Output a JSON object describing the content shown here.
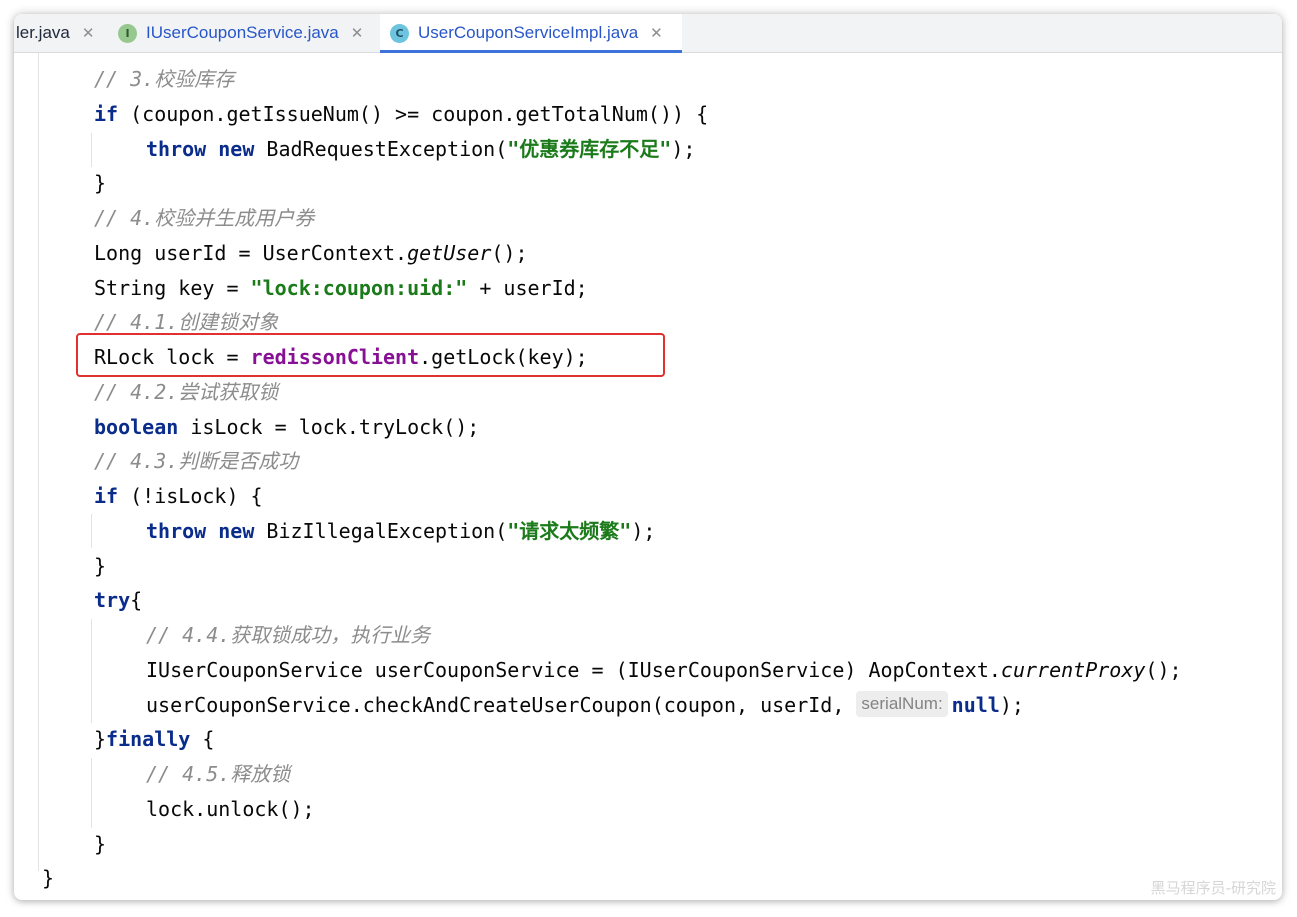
{
  "tabs": [
    {
      "label": "ler.java",
      "close": "✕"
    },
    {
      "label": "IUserCouponService.java",
      "icon_letter": "I",
      "close": "✕"
    },
    {
      "label": "UserCouponServiceImpl.java",
      "icon_letter": "C",
      "close": "✕"
    }
  ],
  "code": {
    "l1_cmt": "// 3.校验库存",
    "l2_if": "if",
    "l2_rest": " (coupon.getIssueNum() >= coupon.getTotalNum()) {",
    "l3_throw": "throw",
    "l3_new": "new",
    "l3_mid": " BadRequestException(",
    "l3_str": "\"优惠券库存不足\"",
    "l3_end": ");",
    "l4": "}",
    "l5_cmt": "// 4.校验并生成用户券",
    "l6_a": "Long userId = UserContext.",
    "l6_b": "getUser",
    "l6_c": "();",
    "l7_a": "String key = ",
    "l7_str": "\"lock:coupon:uid:\"",
    "l7_c": " + userId;",
    "l8_cmt": "// 4.1.创建锁对象",
    "l9_a": "RLock lock = ",
    "l9_fld": "redissonClient",
    "l9_c": ".getLock(key);",
    "l10_cmt": "// 4.2.尝试获取锁",
    "l11_kw": "boolean",
    "l11_rest": " isLock = lock.tryLock();",
    "l12_cmt": "// 4.3.判断是否成功",
    "l13_if": "if",
    "l13_rest": " (!isLock) {",
    "l14_throw": "throw",
    "l14_new": "new",
    "l14_mid": " BizIllegalException(",
    "l14_str": "\"请求太频繁\"",
    "l14_end": ");",
    "l15": "}",
    "l16_kw": "try",
    "l16_b": "{",
    "l17_cmt": "// 4.4.获取锁成功，执行业务",
    "l18_a": "IUserCouponService userCouponService = (IUserCouponService) AopContext.",
    "l18_b": "currentProxy",
    "l18_c": "();",
    "l19_a": "userCouponService.checkAndCreateUserCoupon(coupon, userId, ",
    "l19_hint": "serialNum:",
    "l19_null": "null",
    "l19_end": ");",
    "l20_a": "}",
    "l20_kw": "finally",
    "l20_c": " {",
    "l21_cmt": "// 4.5.释放锁",
    "l22": "lock.unlock();",
    "l23": "}",
    "l24": "}"
  },
  "watermark": "黑马程序员-研究院"
}
